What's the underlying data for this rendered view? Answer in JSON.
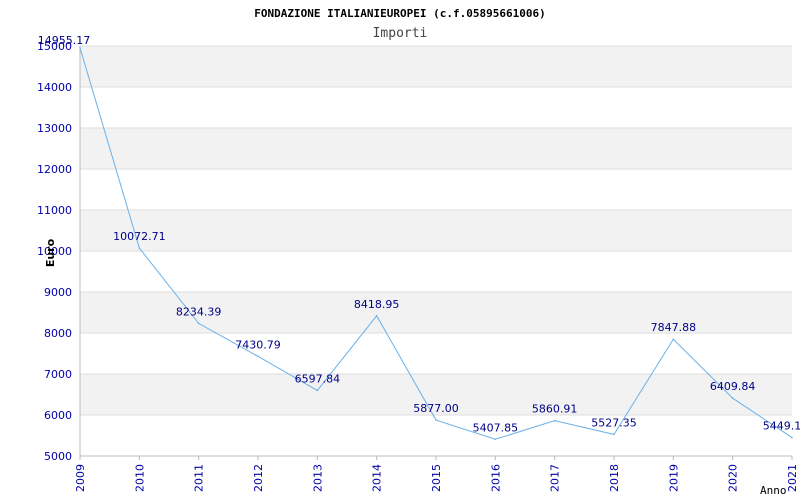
{
  "chart_data": {
    "type": "line",
    "title": "FONDAZIONE ITALIANIEUROPEI (c.f.05895661006)",
    "subtitle": "Importi",
    "xlabel": "Anno",
    "ylabel": "Euro",
    "x": [
      "2009",
      "2010",
      "2011",
      "2012",
      "2013",
      "2014",
      "2015",
      "2016",
      "2017",
      "2018",
      "2019",
      "2020",
      "2021"
    ],
    "series": [
      {
        "values": [
          14955.17,
          10072.71,
          8234.39,
          7430.79,
          6597.84,
          8418.95,
          5877.0,
          5407.85,
          5860.91,
          5527.35,
          7847.88,
          6409.84,
          5449.1
        ]
      }
    ],
    "data_labels": [
      "14955.17",
      "10072.71",
      "8234.39",
      "7430.79",
      "6597.84",
      "8418.95",
      "5877.00",
      "5407.85",
      "5860.91",
      "5527.35",
      "7847.88",
      "6409.84",
      "5449.1"
    ],
    "ylim": [
      5000,
      15000
    ],
    "yticks": [
      "5000",
      "6000",
      "7000",
      "8000",
      "9000",
      "10000",
      "11000",
      "12000",
      "13000",
      "14000",
      "15000"
    ],
    "grid": true,
    "legend": "none",
    "colors": {
      "line": "#6ab0e8",
      "axis_text": "#0000aa",
      "label_text": "#000088",
      "title_text": "#000000",
      "band": "#f2f2f2",
      "grid": "#dddddd"
    }
  }
}
